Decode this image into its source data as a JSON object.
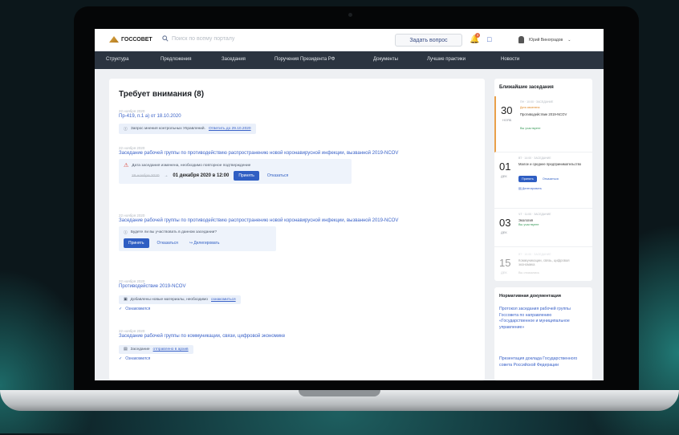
{
  "header": {
    "logo": "ГОССОВЕТ",
    "search_placeholder": "Поиск по всему порталу",
    "ask_label": "Задать вопрос",
    "notif_count": "3",
    "user_name": "Юрий Виноградов"
  },
  "nav": [
    "Структура",
    "Предложения",
    "Заседания",
    "Поручения Президента РФ",
    "Документы",
    "Лучшие практики",
    "Новости"
  ],
  "main": {
    "title": "Требует внимания (8)",
    "items": [
      {
        "date": "22 ноября 2020",
        "link": "Пр-419, п.1 а) от 18.10.2020",
        "note": "Запрос мнения контрольных Управлений.",
        "note_link": "Ответить до 29.10.2020"
      },
      {
        "date": "22 ноября 2020",
        "link": "Заседание рабочей группы по противодействию распространению новой коронавирусной инфекции, вызванной 2019-NCOV",
        "warn": "Дата заседания изменена, необходимо повторное подтверждение",
        "old_date": "28 ноября 2020",
        "new_date": "01 декабря 2020 в 12:00",
        "accept": "Принять",
        "decline": "Отказаться"
      },
      {
        "date": "22 ноября 2020",
        "link": "Заседание рабочей группы по противодействию распространению новой коронавирусной инфекции, вызванной 2019-NCOV",
        "question": "Будете ли вы участвовать в данном заседании?",
        "accept": "Принять",
        "decline": "Отказаться",
        "delegate": "Делегировать"
      },
      {
        "date": "22 ноября 2020",
        "link": "Противодействие 2019-NCOV",
        "note": "Добавлены новые материалы, необходимо",
        "note_link": "ознакомиться",
        "ok": "Ознакомился"
      },
      {
        "date": "22 ноября 2020",
        "link": "Заседание рабочей группы по коммуникации, связи, цифровой экономике",
        "note": "Заседание",
        "note_link": "отправлено в архив",
        "ok": "Ознакомился"
      }
    ]
  },
  "side": {
    "title": "Ближайшие заседания",
    "meetings": [
      {
        "day": "30",
        "mon": "НОЯБ",
        "meta": "ПН · 10:00 · ЗАСЕДАНИЕ",
        "alert": "Дата изменена",
        "title": "Противодействие 2019-NCOV",
        "status": "Вы участвуете"
      },
      {
        "day": "01",
        "mon": "ДЕК",
        "meta": "ВТ · 14:00 · ЗАСЕДАНИЕ",
        "title": "Малое и среднее предпринимательство",
        "accept": "Принять",
        "decline": "Отказаться",
        "delegate": "Делегировать"
      },
      {
        "day": "03",
        "mon": "ДЕК",
        "meta": "ЧТ · 11:00 · ЗАСЕДАНИЕ",
        "title": "Экология",
        "status": "Вы участвуете"
      },
      {
        "day": "15",
        "mon": "ДЕК",
        "meta": "ВТ · 10:00 · ЗАСЕДАНИЕ",
        "title": "Коммуникации, связь, цифровая экономика",
        "status": "Вы отказались"
      }
    ]
  },
  "docs": {
    "title": "Нормативная документация",
    "link1": "Протокол заседания рабочей группы Госсовета по направлению «Государственное и муниципальное управление»",
    "link2": "Презентация доклада Государственного совета Российской Федерации"
  }
}
